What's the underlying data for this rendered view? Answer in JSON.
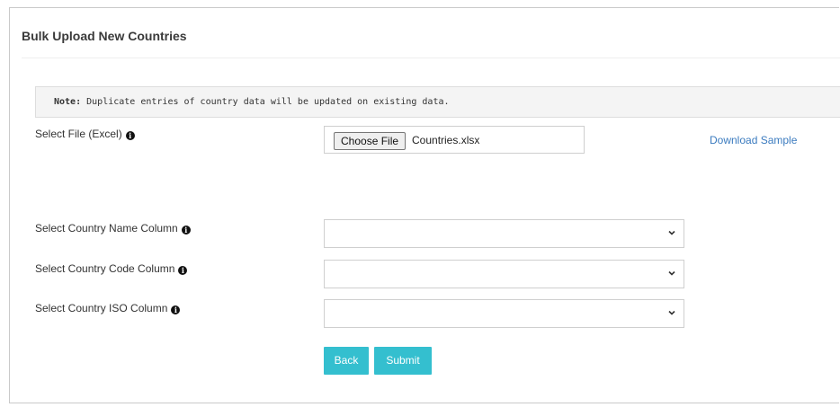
{
  "page": {
    "title": "Bulk Upload New Countries"
  },
  "note": {
    "prefix": "Note:",
    "text": " Duplicate entries of country data will be updated on existing data."
  },
  "file_field": {
    "label": "Select File (Excel)",
    "button_label": "Choose File",
    "file_name": "Countries.xlsx"
  },
  "download_sample": "Download Sample",
  "selects": [
    {
      "label": "Select Country Name Column",
      "value": ""
    },
    {
      "label": "Select Country Code Column",
      "value": ""
    },
    {
      "label": "Select Country ISO Column",
      "value": ""
    }
  ],
  "buttons": {
    "back": "Back",
    "submit": "Submit"
  },
  "icons": {
    "info": "info-circle-icon",
    "chevron": "chevron-down-icon"
  },
  "colors": {
    "accent": "#34bfcf",
    "link": "#3b7bbf"
  }
}
